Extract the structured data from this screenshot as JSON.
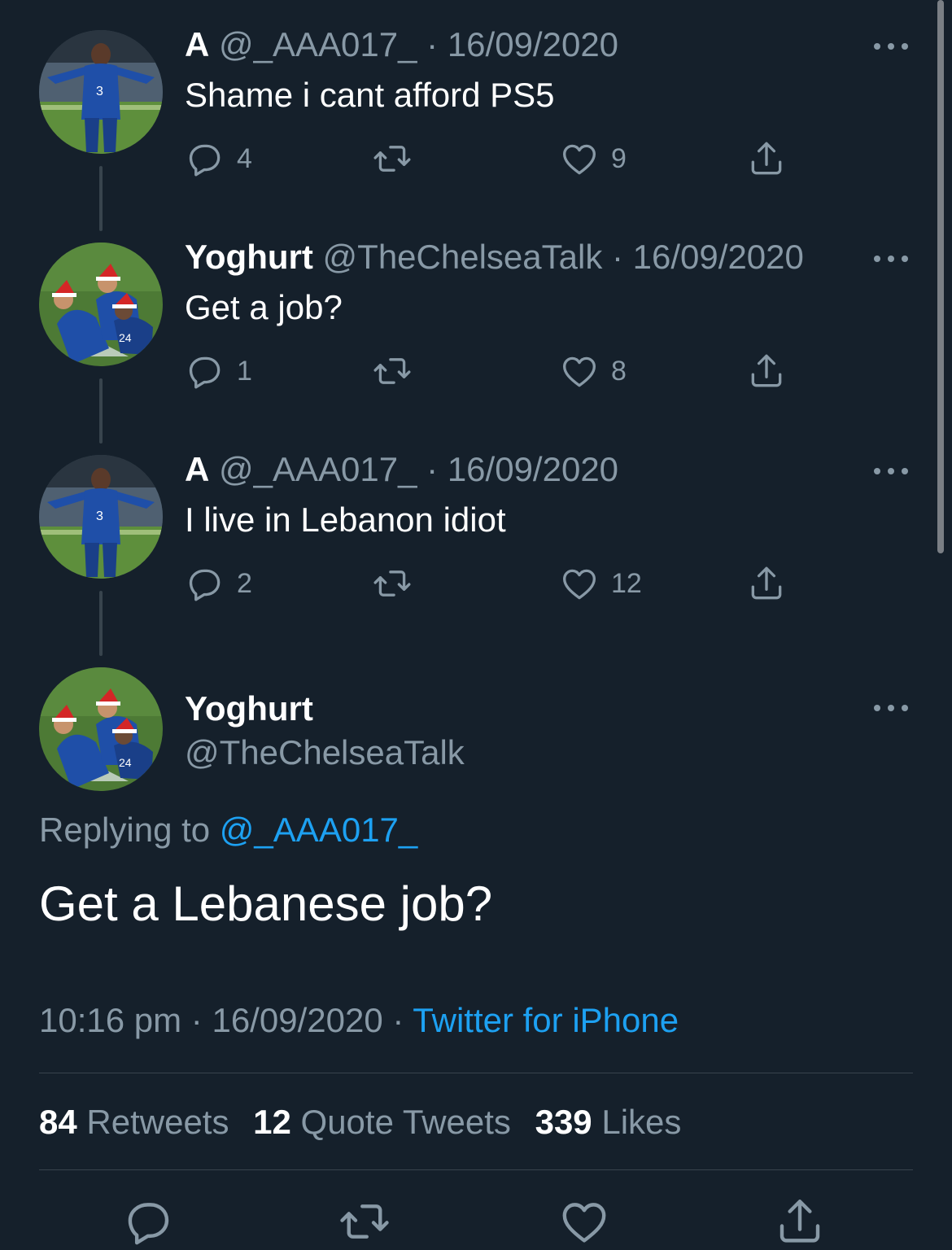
{
  "thread": [
    {
      "name": "A",
      "handle": "@_AAA017_",
      "sep": "·",
      "date": "16/09/2020",
      "text": "Shame i cant afford PS5",
      "replies": "4",
      "likes": "9",
      "avatar": "player-celebrating"
    },
    {
      "name": "Yoghurt",
      "handle": "@TheChelseaTalk",
      "sep": "·",
      "date": "16/09/2020",
      "text": "Get a job?",
      "replies": "1",
      "likes": "8",
      "avatar": "players-santa-hats"
    },
    {
      "name": "A",
      "handle": "@_AAA017_",
      "sep": "·",
      "date": "16/09/2020",
      "text": "I live in Lebanon idiot",
      "replies": "2",
      "likes": "12",
      "avatar": "player-celebrating"
    }
  ],
  "main_tweet": {
    "name": "Yoghurt",
    "handle": "@TheChelseaTalk",
    "replying_prefix": "Replying to ",
    "replying_handle": "@_AAA017_",
    "text": "Get a Lebanese job?",
    "time": "10:16 pm",
    "sep": "·",
    "date": "16/09/2020",
    "source": "Twitter for iPhone",
    "avatar": "players-santa-hats"
  },
  "stats": {
    "retweets_count": "84",
    "retweets_label": "Retweets",
    "quotes_count": "12",
    "quotes_label": "Quote Tweets",
    "likes_count": "339",
    "likes_label": "Likes"
  },
  "colors": {
    "background": "#15202b",
    "text_primary": "#ffffff",
    "text_secondary": "#8899a6",
    "link": "#1da1f2",
    "divider": "#38444d"
  },
  "icons": [
    "reply-icon",
    "retweet-icon",
    "like-icon",
    "share-icon",
    "more-icon"
  ]
}
